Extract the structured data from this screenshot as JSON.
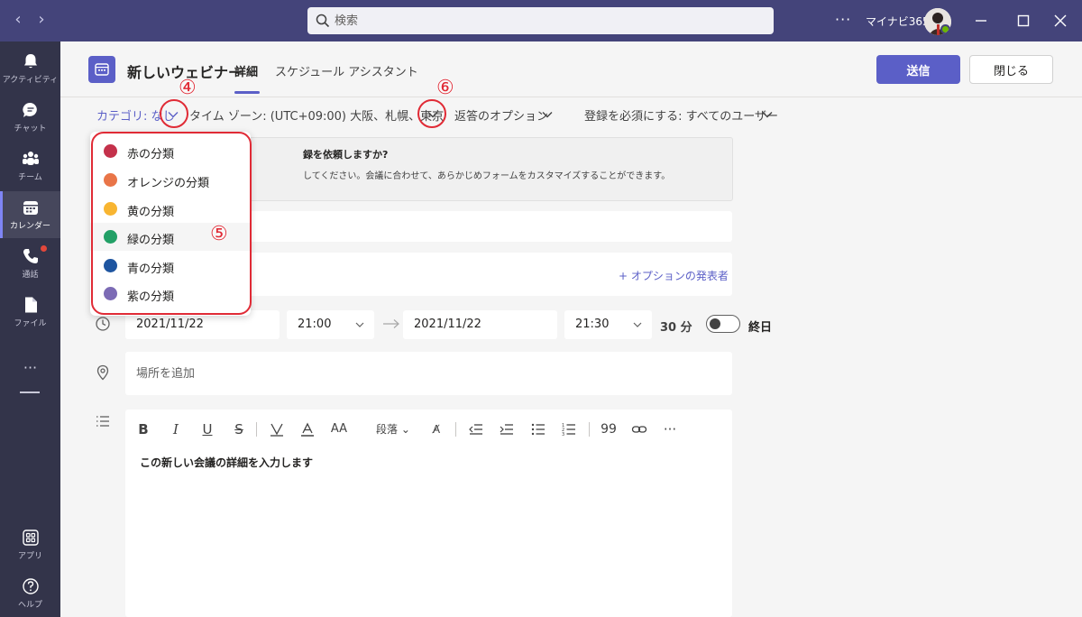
{
  "titlebar": {
    "search_placeholder": "検索",
    "more": "···",
    "org_name": "マイナビ365"
  },
  "rail": {
    "items": [
      {
        "label": "アクティビティ",
        "icon": "bell-icon"
      },
      {
        "label": "チャット",
        "icon": "chat-icon"
      },
      {
        "label": "チーム",
        "icon": "teams-icon"
      },
      {
        "label": "カレンダー",
        "icon": "calendar-icon"
      },
      {
        "label": "通話",
        "icon": "phone-icon"
      },
      {
        "label": "ファイル",
        "icon": "file-icon"
      },
      {
        "label": "アプリ",
        "icon": "apps-icon"
      },
      {
        "label": "ヘルプ",
        "icon": "help-icon"
      }
    ],
    "more": "···"
  },
  "header": {
    "title": "新しいウェビナー",
    "tabs": [
      {
        "label": "詳細"
      },
      {
        "label": "スケジュール アシスタント"
      }
    ],
    "send_label": "送信",
    "close_label": "閉じる"
  },
  "options": {
    "category": "カテゴリ: なし",
    "timezone": "タイム ゾーン: (UTC+09:00) 大阪、札幌、東京",
    "response": "返答のオプション",
    "registration": "登録を必須にする: すべてのユーザー"
  },
  "banner": {
    "title": "録を依頼しますか?",
    "desc": "してください。会議に合わせて、あらかじめフォームをカスタマイズすることができます。"
  },
  "presenter_link": "+ オプションの発表者",
  "datetime": {
    "start_date": "2021/11/22",
    "start_time": "21:00",
    "end_date": "2021/11/22",
    "end_time": "21:30",
    "duration": "30 分",
    "all_day": "終日"
  },
  "location_placeholder": "場所を追加",
  "editor": {
    "paragraph_label": "段落",
    "body": "この新しい会議の詳細を入力します"
  },
  "category_menu": {
    "items": [
      {
        "label": "赤の分類",
        "color": "#c4314b"
      },
      {
        "label": "オレンジの分類",
        "color": "#e97548"
      },
      {
        "label": "黄の分類",
        "color": "#f8b531"
      },
      {
        "label": "緑の分類",
        "color": "#22a066"
      },
      {
        "label": "青の分類",
        "color": "#1e55a0"
      },
      {
        "label": "紫の分類",
        "color": "#7c6bb5"
      }
    ]
  },
  "annotations": {
    "n4": "④",
    "n5": "⑤",
    "n6": "⑥"
  }
}
